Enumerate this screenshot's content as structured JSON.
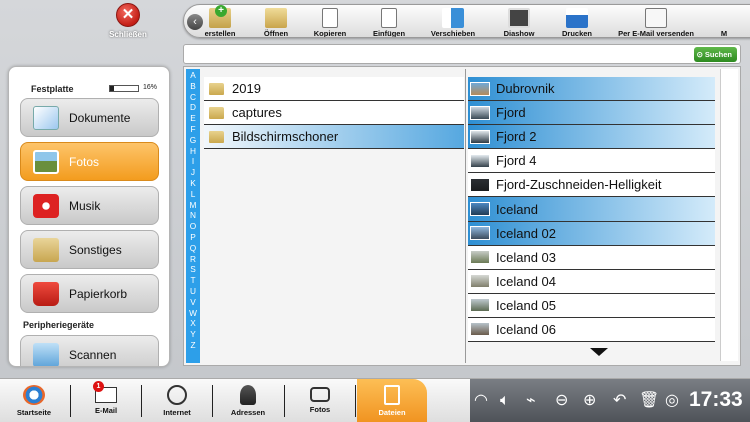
{
  "close": {
    "label": "Schließen",
    "icon": "close-icon"
  },
  "toolbar": {
    "items": [
      {
        "label": "erstellen",
        "icon": "create-folder-icon"
      },
      {
        "label": "Öffnen",
        "icon": "open-folder-icon"
      },
      {
        "label": "Kopieren",
        "icon": "copy-icon"
      },
      {
        "label": "Einfügen",
        "icon": "paste-icon"
      },
      {
        "label": "Verschieben",
        "icon": "move-icon"
      },
      {
        "label": "Diashow",
        "icon": "slideshow-icon"
      },
      {
        "label": "Drucken",
        "icon": "printer-icon"
      },
      {
        "label": "Per E-Mail versenden",
        "icon": "email-send-icon"
      },
      {
        "label": "M",
        "icon": "more-icon"
      }
    ]
  },
  "search": {
    "button_label": "Suchen",
    "value": ""
  },
  "sidebar": {
    "storage_title": "Festplatte",
    "storage_percent_label": "16%",
    "storage_fraction": 0.16,
    "categories": [
      {
        "label": "Dokumente",
        "icon": "documents-icon"
      },
      {
        "label": "Fotos",
        "icon": "photos-icon"
      },
      {
        "label": "Musik",
        "icon": "music-icon"
      },
      {
        "label": "Sonstiges",
        "icon": "folder-icon"
      },
      {
        "label": "Papierkorb",
        "icon": "trash-icon"
      }
    ],
    "peripherals_title": "Peripheriegeräte",
    "peripheral_item": "Scannen"
  },
  "alphabet": [
    "A",
    "B",
    "C",
    "D",
    "E",
    "F",
    "G",
    "H",
    "I",
    "J",
    "K",
    "L",
    "M",
    "N",
    "O",
    "P",
    "Q",
    "R",
    "S",
    "T",
    "U",
    "V",
    "W",
    "X",
    "Y",
    "Z"
  ],
  "folders": [
    "2019",
    "captures",
    "Bildschirmschoner"
  ],
  "files": [
    "Dubrovnik",
    "Fjord",
    "Fjord 2",
    "Fjord 4",
    "Fjord-Zuschneiden-Helligkeit",
    "Iceland",
    "Iceland 02",
    "Iceland 03",
    "Iceland 04",
    "Iceland 05",
    "Iceland 06"
  ],
  "taskbar": {
    "items": [
      {
        "label": "Startseite",
        "icon": "home-icon"
      },
      {
        "label": "E-Mail",
        "icon": "email-icon"
      },
      {
        "label": "Internet",
        "icon": "globe-icon"
      },
      {
        "label": "Adressen",
        "icon": "contacts-icon"
      },
      {
        "label": "Fotos",
        "icon": "camera-icon"
      },
      {
        "label": "Dateien",
        "icon": "files-icon"
      }
    ],
    "email_badge": "1",
    "clock": "17:33"
  },
  "colors": {
    "accent_orange": "#f39c1e",
    "selection_blue": "#2e8fd3",
    "alphabet_blue": "#2d9fe9"
  }
}
